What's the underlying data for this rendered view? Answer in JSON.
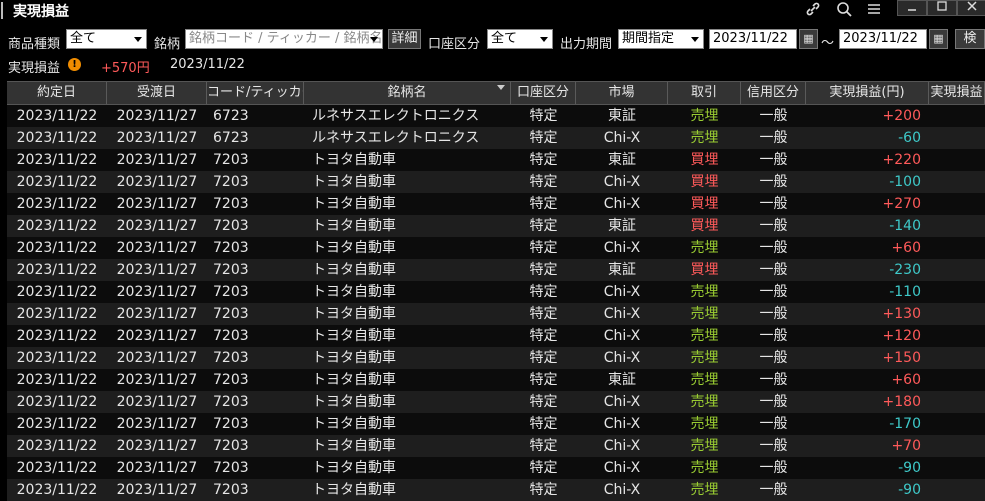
{
  "window": {
    "title": "実現損益",
    "icons": [
      "link-icon",
      "search-icon",
      "menu-icon"
    ],
    "controls": [
      "minimize",
      "maximize",
      "close"
    ]
  },
  "filters": {
    "product_type_label": "商品種類",
    "product_type_value": "全て",
    "symbol_label": "銘柄",
    "symbol_placeholder": "銘柄コード / ティッカー / 銘柄名",
    "detail_button": "詳細",
    "account_label": "口座区分",
    "account_value": "全て",
    "period_label": "出力期間",
    "period_value": "期間指定",
    "date_from": "2023/11/22",
    "tilde": "～",
    "date_to": "2023/11/22",
    "search_button": "検"
  },
  "summary": {
    "label": "実現損益",
    "amount": "+570円",
    "date": "2023/11/22",
    "amount_color": "#ff5a5a",
    "warning_icon": "!"
  },
  "table": {
    "columns": [
      "約定日",
      "受渡日",
      "コード/ティッカー",
      "銘柄名",
      "口座区分",
      "市場",
      "取引",
      "信用区分",
      "実現損益(円)",
      "実現損益"
    ],
    "rows": [
      [
        "2023/11/22",
        "2023/11/27",
        "6723",
        "ルネサスエレクトロニクス",
        "特定",
        "東証",
        "売埋",
        "一般",
        "+200"
      ],
      [
        "2023/11/22",
        "2023/11/27",
        "6723",
        "ルネサスエレクトロニクス",
        "特定",
        "Chi-X",
        "売埋",
        "一般",
        "-60"
      ],
      [
        "2023/11/22",
        "2023/11/27",
        "7203",
        "トヨタ自動車",
        "特定",
        "東証",
        "買埋",
        "一般",
        "+220"
      ],
      [
        "2023/11/22",
        "2023/11/27",
        "7203",
        "トヨタ自動車",
        "特定",
        "Chi-X",
        "買埋",
        "一般",
        "-100"
      ],
      [
        "2023/11/22",
        "2023/11/27",
        "7203",
        "トヨタ自動車",
        "特定",
        "Chi-X",
        "買埋",
        "一般",
        "+270"
      ],
      [
        "2023/11/22",
        "2023/11/27",
        "7203",
        "トヨタ自動車",
        "特定",
        "東証",
        "買埋",
        "一般",
        "-140"
      ],
      [
        "2023/11/22",
        "2023/11/27",
        "7203",
        "トヨタ自動車",
        "特定",
        "Chi-X",
        "売埋",
        "一般",
        "+60"
      ],
      [
        "2023/11/22",
        "2023/11/27",
        "7203",
        "トヨタ自動車",
        "特定",
        "東証",
        "買埋",
        "一般",
        "-230"
      ],
      [
        "2023/11/22",
        "2023/11/27",
        "7203",
        "トヨタ自動車",
        "特定",
        "Chi-X",
        "売埋",
        "一般",
        "-110"
      ],
      [
        "2023/11/22",
        "2023/11/27",
        "7203",
        "トヨタ自動車",
        "特定",
        "Chi-X",
        "売埋",
        "一般",
        "+130"
      ],
      [
        "2023/11/22",
        "2023/11/27",
        "7203",
        "トヨタ自動車",
        "特定",
        "Chi-X",
        "売埋",
        "一般",
        "+120"
      ],
      [
        "2023/11/22",
        "2023/11/27",
        "7203",
        "トヨタ自動車",
        "特定",
        "Chi-X",
        "売埋",
        "一般",
        "+150"
      ],
      [
        "2023/11/22",
        "2023/11/27",
        "7203",
        "トヨタ自動車",
        "特定",
        "東証",
        "売埋",
        "一般",
        "+60"
      ],
      [
        "2023/11/22",
        "2023/11/27",
        "7203",
        "トヨタ自動車",
        "特定",
        "Chi-X",
        "売埋",
        "一般",
        "+180"
      ],
      [
        "2023/11/22",
        "2023/11/27",
        "7203",
        "トヨタ自動車",
        "特定",
        "Chi-X",
        "売埋",
        "一般",
        "-170"
      ],
      [
        "2023/11/22",
        "2023/11/27",
        "7203",
        "トヨタ自動車",
        "特定",
        "Chi-X",
        "売埋",
        "一般",
        "+70"
      ],
      [
        "2023/11/22",
        "2023/11/27",
        "7203",
        "トヨタ自動車",
        "特定",
        "Chi-X",
        "売埋",
        "一般",
        "-90"
      ],
      [
        "2023/11/22",
        "2023/11/27",
        "7203",
        "トヨタ自動車",
        "特定",
        "Chi-X",
        "売埋",
        "一般",
        "-90"
      ]
    ]
  },
  "colors": {
    "sell_close": "#9acd32",
    "buy_close": "#ff5a5a",
    "profit": "#ff5a5a",
    "loss": "#3ec9c9"
  }
}
